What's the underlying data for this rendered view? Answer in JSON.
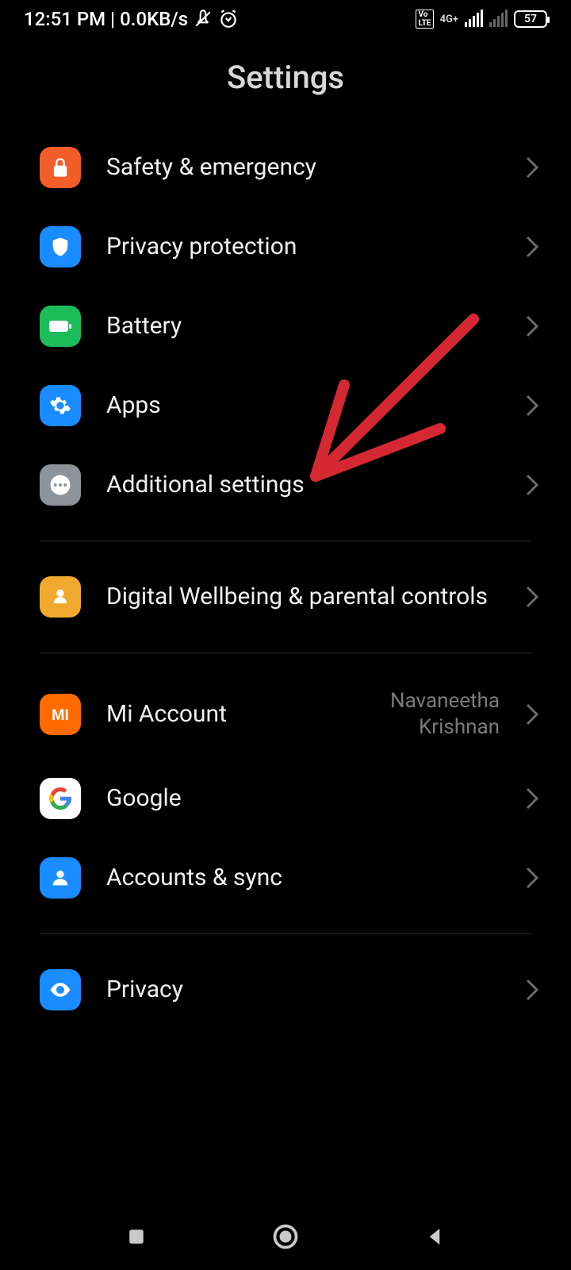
{
  "status": {
    "time": "12:51 PM",
    "speed": "0.0KB/s",
    "volte": "Vo LTE",
    "network": "4G+",
    "battery": "57"
  },
  "header": {
    "title": "Settings"
  },
  "groups": [
    {
      "items": [
        {
          "key": "safety",
          "label": "Safety & emergency",
          "iconBg": "#f25d29",
          "iconName": "safety-icon"
        },
        {
          "key": "privacyp",
          "label": "Privacy protection",
          "iconBg": "#1a8cff",
          "iconName": "shield-icon"
        },
        {
          "key": "battery",
          "label": "Battery",
          "iconBg": "#1bbd5b",
          "iconName": "battery-icon"
        },
        {
          "key": "apps",
          "label": "Apps",
          "iconBg": "#1a8cff",
          "iconName": "gear-icon"
        },
        {
          "key": "additional",
          "label": "Additional settings",
          "iconBg": "#8c939b",
          "iconName": "ellipsis-icon"
        }
      ]
    },
    {
      "items": [
        {
          "key": "wellbeing",
          "label": "Digital Wellbeing & parental controls",
          "iconBg": "#f0a92e",
          "iconName": "wellbeing-icon"
        }
      ]
    },
    {
      "items": [
        {
          "key": "mi",
          "label": "Mi Account",
          "value": "Navaneetha Krishnan",
          "iconBg": "#ff6b00",
          "iconName": "mi-icon"
        },
        {
          "key": "google",
          "label": "Google",
          "iconBg": "#ffffff",
          "iconName": "google-icon"
        },
        {
          "key": "accounts",
          "label": "Accounts & sync",
          "iconBg": "#1a8cff",
          "iconName": "person-icon"
        }
      ]
    },
    {
      "items": [
        {
          "key": "privacy",
          "label": "Privacy",
          "iconBg": "#1a8cff",
          "iconName": "eye-icon"
        }
      ]
    }
  ],
  "annotation": {
    "type": "arrow",
    "targetKey": "additional",
    "color": "#d62832"
  }
}
